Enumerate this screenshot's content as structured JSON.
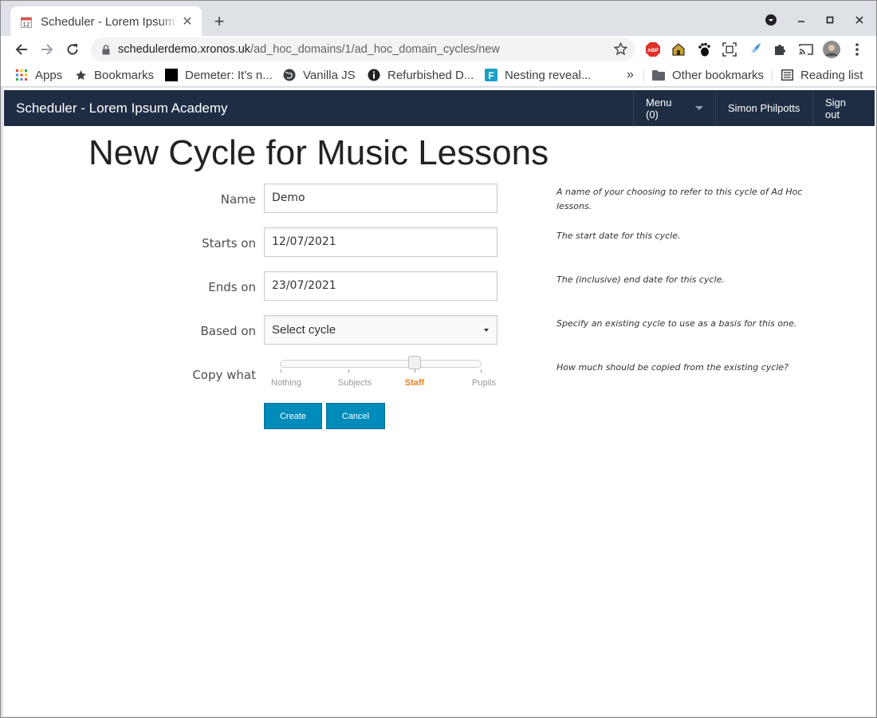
{
  "browser": {
    "tab_title": "Scheduler - Lorem Ipsum Academy",
    "url_host": "schedulerdemo.xronos.uk",
    "url_path": "/ad_hoc_domains/1/ad_hoc_domain_cycles/new",
    "bookmarks": [
      {
        "label": "Apps",
        "icon": "apps-grid-icon"
      },
      {
        "label": "Bookmarks",
        "icon": "star-icon"
      },
      {
        "label": "Demeter: It’s n...",
        "icon": "black-square-icon"
      },
      {
        "label": "Vanilla JS",
        "icon": "globe-icon"
      },
      {
        "label": "Refurbished D...",
        "icon": "info-circle-icon"
      },
      {
        "label": "Nesting reveal...",
        "icon": "f-logo-icon"
      }
    ],
    "bookmarks_overflow": "»",
    "other_bookmarks": "Other bookmarks",
    "reading_list": "Reading list",
    "extensions": [
      "abp-icon",
      "extension-house-icon",
      "gnome-foot-icon",
      "screenshot-icon",
      "feather-icon",
      "puzzle-icon",
      "cast-icon",
      "profile-avatar"
    ]
  },
  "app": {
    "brand": "Scheduler - Lorem Ipsum Academy",
    "menu_label": "Menu (0)",
    "user_name": "Simon Philpotts",
    "sign_out": "Sign out"
  },
  "form": {
    "heading": "New Cycle for Music Lessons",
    "name": {
      "label": "Name",
      "value": "Demo",
      "hint": "A name of your choosing to refer to this cycle of Ad Hoc lessons."
    },
    "starts_on": {
      "label": "Starts on",
      "value": "12/07/2021",
      "hint": "The start date for this cycle."
    },
    "ends_on": {
      "label": "Ends on",
      "value": "23/07/2021",
      "hint": "The (inclusive) end date for this cycle."
    },
    "based_on": {
      "label": "Based on",
      "value": "Select cycle",
      "hint": "Specify an existing cycle to use as a basis for this one."
    },
    "copy_what": {
      "label": "Copy what",
      "hint": "How much should be copied from the existing cycle?",
      "options": [
        "Nothing",
        "Subjects",
        "Staff",
        "Pupils"
      ],
      "selected": "Staff",
      "selected_index": 2
    },
    "create_label": "Create",
    "cancel_label": "Cancel"
  },
  "colors": {
    "navbar": "#1f2d44",
    "button": "#008cba",
    "slider_active": "#f07d1a"
  }
}
